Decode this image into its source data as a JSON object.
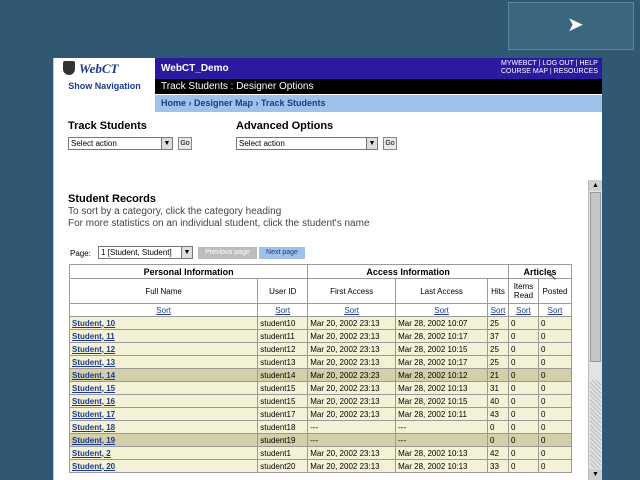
{
  "course": {
    "brand": "WebCT",
    "show_nav": "Show Navigation",
    "title": "WebCT_Demo",
    "top_links": [
      "MYWEBCT",
      "LOG OUT",
      "HELP",
      "COURSE MAP",
      "RESOURCES"
    ],
    "path": "Track Students : Designer Options",
    "breadcrumb": [
      "Home",
      "Designer Map",
      "Track Students"
    ]
  },
  "track_students": {
    "heading": "Track Students",
    "select_value": "Select action",
    "go_label": "Go"
  },
  "advanced_options": {
    "heading": "Advanced Options",
    "select_value": "Select action",
    "go_label": "Go"
  },
  "records": {
    "heading": "Student Records",
    "instr1": "To sort by a category, click the category heading",
    "instr2": "For more statistics on an individual student, click the student's name",
    "page_label": "Page:",
    "page_value": "1 [Student, Student]",
    "prev_label": "Previous page",
    "next_label": "Next page"
  },
  "table": {
    "groups": [
      "Personal Information",
      "Access Information",
      "Articles"
    ],
    "columns": [
      "Full Name",
      "User ID",
      "First Access",
      "Last Access",
      "Hits",
      "Items Read",
      "Posted"
    ],
    "sort_label": "Sort",
    "rows": [
      {
        "name": "Student, 10",
        "uid": "student10",
        "first": "Mar 20, 2002 23:13",
        "last": "Mar 28, 2002 10:07",
        "hits": "25",
        "read": "0",
        "posted": "0"
      },
      {
        "name": "Student, 11",
        "uid": "student11",
        "first": "Mar 20, 2002 23:13",
        "last": "Mar 28, 2002 10:17",
        "hits": "37",
        "read": "0",
        "posted": "0"
      },
      {
        "name": "Student, 12",
        "uid": "student12",
        "first": "Mar 20, 2002 23:13",
        "last": "Mar 28, 2002 10:15",
        "hits": "25",
        "read": "0",
        "posted": "0"
      },
      {
        "name": "Student, 13",
        "uid": "student13",
        "first": "Mar 20, 2002 23:13",
        "last": "Mar 28, 2002 10:17",
        "hits": "25",
        "read": "0",
        "posted": "0"
      },
      {
        "name": "Student, 14",
        "uid": "student14",
        "first": "Mar 20, 2002 23:23",
        "last": "Mar 28, 2002 10:12",
        "hits": "21",
        "read": "0",
        "posted": "0"
      },
      {
        "name": "Student, 15",
        "uid": "student15",
        "first": "Mar 20, 2002 23:13",
        "last": "Mar 28, 2002 10:13",
        "hits": "31",
        "read": "0",
        "posted": "0"
      },
      {
        "name": "Student, 16",
        "uid": "student15",
        "first": "Mar 20, 2002 23:13",
        "last": "Mar 28, 2002 10:15",
        "hits": "40",
        "read": "0",
        "posted": "0"
      },
      {
        "name": "Student, 17",
        "uid": "student17",
        "first": "Mar 20, 2002 23:13",
        "last": "Mar 28, 2002 10:11",
        "hits": "43",
        "read": "0",
        "posted": "0"
      },
      {
        "name": "Student, 18",
        "uid": "student18",
        "first": "---",
        "last": "---",
        "hits": "0",
        "read": "0",
        "posted": "0"
      },
      {
        "name": "Student, 19",
        "uid": "student19",
        "first": "---",
        "last": "---",
        "hits": "0",
        "read": "0",
        "posted": "0"
      },
      {
        "name": "Student, 2",
        "uid": "student1",
        "first": "Mar 20, 2002 23:13",
        "last": "Mar 28, 2002 10:13",
        "hits": "42",
        "read": "0",
        "posted": "0"
      },
      {
        "name": "Student, 20",
        "uid": "student20",
        "first": "Mar 20, 2002 23:13",
        "last": "Mar 28, 2002 10:13",
        "hits": "33",
        "read": "0",
        "posted": "0"
      }
    ]
  }
}
